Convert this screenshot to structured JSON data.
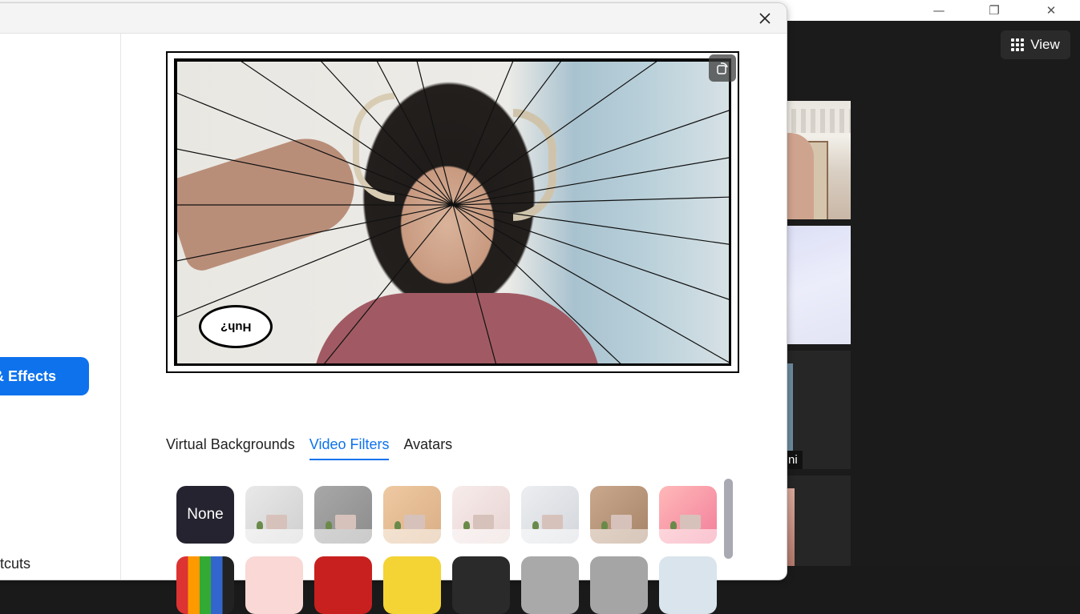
{
  "zoom_window": {
    "view_label": "View",
    "participant_name_fragment": "ni"
  },
  "dialog": {
    "sidebar": {
      "active_item_label": "& Effects",
      "shortcuts_label": "tcuts"
    },
    "preview": {
      "speech_bubble_text": "Huh?"
    },
    "tabs": [
      {
        "label": "Virtual Backgrounds",
        "active": false
      },
      {
        "label": "Video Filters",
        "active": true
      },
      {
        "label": "Avatars",
        "active": false
      }
    ],
    "filters": {
      "none_label": "None"
    }
  },
  "colors": {
    "accent": "#0e72ed"
  }
}
